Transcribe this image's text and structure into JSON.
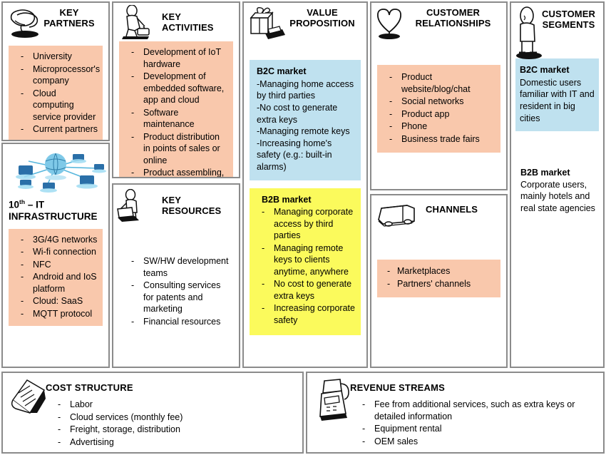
{
  "blocks": {
    "key_partners": {
      "title": "KEY\nPARTNERS",
      "icon": "handshake-icon",
      "items": [
        "University",
        "Microprocessor's company",
        "Cloud computing service provider",
        "Current partners"
      ]
    },
    "it_infrastructure": {
      "title_number": "10",
      "title_sup": "th",
      "title_rest": " – IT",
      "title_line2": "INFRASTRUCTURE",
      "icon": "network-globe-icon",
      "items": [
        "3G/4G networks",
        "Wi-fi connection",
        "NFC",
        "Android and IoS platform",
        "Cloud: SaaS",
        "MQTT protocol"
      ]
    },
    "key_activities": {
      "title": "KEY\nACTIVITIES",
      "icon": "worker-icon",
      "items": [
        "Development of IoT hardware",
        "Development of embedded software, app and cloud",
        "Software maintenance",
        "Product distribution in points of sales or online",
        "Product assembling, testing and packaging"
      ]
    },
    "key_resources": {
      "title": "KEY\nRESOURCES",
      "icon": "person-pushing-icon",
      "items": [
        "SW/HW development teams",
        "Consulting services for patents and marketing",
        "Financial resources"
      ]
    },
    "value_proposition": {
      "title": "VALUE\nPROPOSITION",
      "icon": "gift-box-icon",
      "b2c": {
        "heading": "B2C market",
        "lines": [
          "-Managing home access by third parties",
          "-No cost to generate extra keys",
          "-Managing remote keys",
          "-Increasing home's safety (e.g.: built-in alarms)"
        ]
      },
      "b2b": {
        "heading": "B2B market",
        "items": [
          "Managing corporate access by third parties",
          "Managing remote keys to clients anytime, anywhere",
          "No cost to generate extra keys",
          "Increasing corporate safety"
        ]
      }
    },
    "customer_relationships": {
      "title": "CUSTOMER\nRELATIONSHIPS",
      "icon": "heart-icon",
      "items": [
        "Product website/blog/chat",
        "Social networks",
        "Product app",
        "Phone",
        "Business trade fairs"
      ]
    },
    "channels": {
      "title": "CHANNELS",
      "icon": "truck-icon",
      "items": [
        "Marketplaces",
        "Partners' channels"
      ]
    },
    "customer_segments": {
      "title": "CUSTOMER\nSEGMENTS",
      "icon": "standing-person-icon",
      "b2c": {
        "heading": "B2C market",
        "body": "Domestic users familiar with IT and resident in big cities"
      },
      "b2b": {
        "heading": "B2B market",
        "body": "Corporate users, mainly hotels and real state agencies"
      }
    },
    "cost_structure": {
      "title": "COST STRUCTURE",
      "icon": "documents-icon",
      "items": [
        "Labor",
        "Cloud services (monthly fee)",
        "Freight, storage, distribution",
        "Advertising"
      ]
    },
    "revenue_streams": {
      "title": "REVENUE STREAMS",
      "icon": "cash-register-icon",
      "items": [
        "Fee from additional services, such as extra keys or detailed information",
        "Equipment rental",
        "OEM sales"
      ]
    }
  },
  "colors": {
    "peach": "#f9c8ac",
    "blue": "#bfe1ef",
    "yellow": "#fbfa5c",
    "green": "#bdf5d6",
    "border": "#8b8b8b"
  }
}
